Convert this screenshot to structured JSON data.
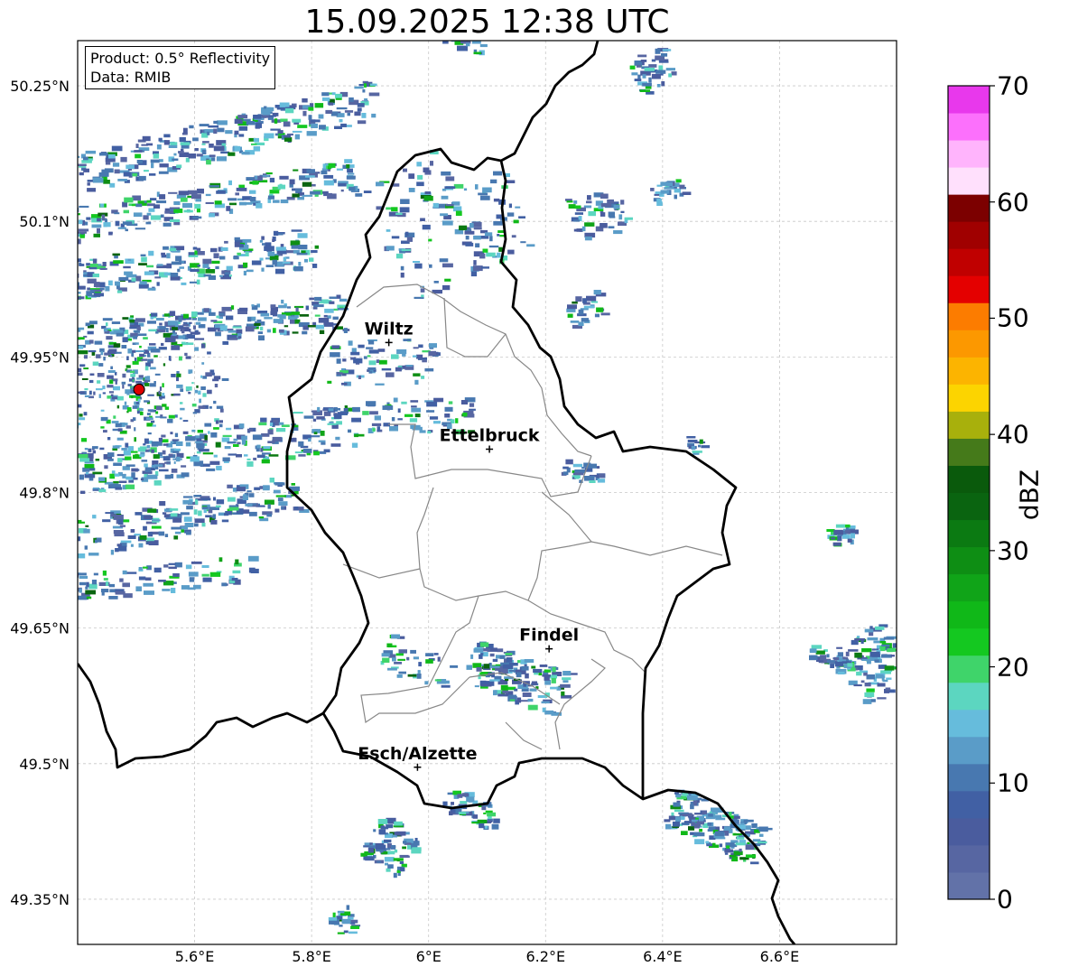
{
  "title": "15.09.2025 12:38 UTC",
  "info": {
    "product": "Product: 0.5° Reflectivity",
    "data": "Data: RMIB"
  },
  "lat_ticks": [
    "50.25°N",
    "50.1°N",
    "49.95°N",
    "49.8°N",
    "49.65°N",
    "49.5°N",
    "49.35°N"
  ],
  "lon_ticks": [
    "5.6°E",
    "5.8°E",
    "6°E",
    "6.2°E",
    "6.4°E",
    "6.6°E"
  ],
  "cities": [
    {
      "name": "Wiltz",
      "lon": 5.932,
      "lat": 49.966
    },
    {
      "name": "Ettelbruck",
      "lon": 6.104,
      "lat": 49.848
    },
    {
      "name": "Findel",
      "lon": 6.206,
      "lat": 49.627
    },
    {
      "name": "Esch/Alzette",
      "lon": 5.981,
      "lat": 49.496
    }
  ],
  "radar_site": {
    "lon": 5.505,
    "lat": 49.914
  },
  "colorbar": {
    "label": "dBZ",
    "ticks": [
      "0",
      "10",
      "20",
      "30",
      "40",
      "50",
      "60",
      "70"
    ],
    "colors": [
      "#6272a8",
      "#5766a2",
      "#4a5c9e",
      "#4160a4",
      "#4878b0",
      "#5a9cc8",
      "#66bcdc",
      "#5cd6c0",
      "#3fd46a",
      "#14c820",
      "#10b818",
      "#10a418",
      "#0e8e14",
      "#0b7a12",
      "#0a6410",
      "#0a5a0c",
      "#457a1a",
      "#a8b00c",
      "#fcd400",
      "#fcb400",
      "#fc9800",
      "#fc7c00",
      "#e40000",
      "#c00000",
      "#a00000",
      "#7c0000",
      "#ffe0fc",
      "#ffb4fc",
      "#fc70fc",
      "#e838ec"
    ]
  }
}
